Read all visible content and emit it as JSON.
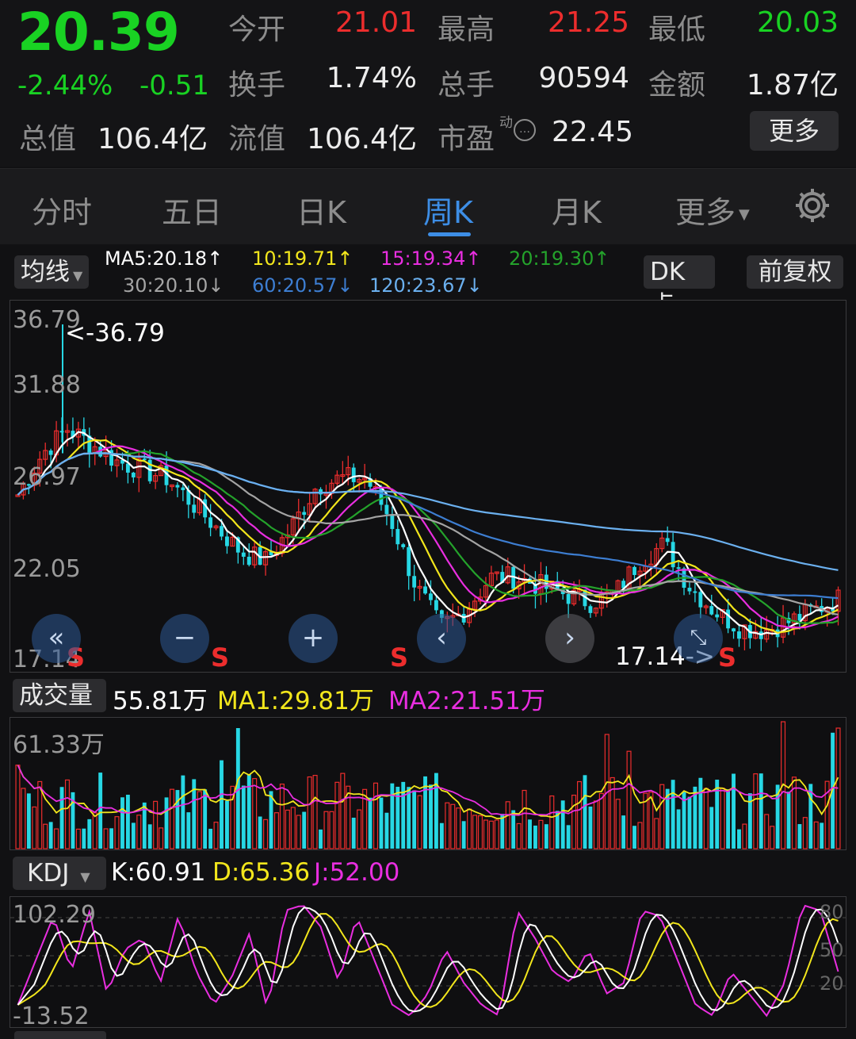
{
  "quote": {
    "price": "20.39",
    "change_pct": "-2.44%",
    "change": "-0.51",
    "open_label": "今开",
    "open": "21.01",
    "high_label": "最高",
    "high": "21.25",
    "low_label": "最低",
    "low": "20.03",
    "turnover_label": "换手",
    "turnover": "1.74%",
    "volume_label": "总手",
    "volume": "90594",
    "amount_label": "金额",
    "amount": "1.87亿",
    "mcap_label": "总值",
    "mcap": "106.4亿",
    "float_label": "流值",
    "float_cap": "106.4亿",
    "pe_label": "市盈",
    "pe_superscript": "动",
    "pe": "22.45",
    "more_label": "更多"
  },
  "tabs": {
    "items": [
      "分时",
      "五日",
      "日K",
      "周K",
      "月K",
      "更多"
    ],
    "active": "周K"
  },
  "ma_legend": {
    "dropdown": "均线",
    "ma5": "MA5:20.18↑",
    "ma10": "10:19.71↑",
    "ma15": "15:19.34↑",
    "ma20": "20:19.30↑",
    "ma30": "30:20.10↓",
    "ma60": "60:20.57↓",
    "ma120": "120:23.67↓",
    "dk_button": "DK点",
    "adjust_button": "前复权"
  },
  "colors": {
    "up": "#ec2d2d",
    "down": "#27d7e4",
    "price_green": "#19d223",
    "ma5": "#ffffff",
    "ma10": "#f2e61c",
    "ma15": "#e92ee0",
    "ma20": "#24a22b",
    "ma30": "#a4a4a4",
    "ma60": "#3d7ed2",
    "ma120": "#6bb0ef",
    "accent": "#3d8ee6"
  },
  "kline": {
    "y_labels": [
      "36.79",
      "31.88",
      "26.97",
      "22.05",
      "17.14"
    ],
    "max_mark": "<-36.79",
    "min_mark": "17.14->",
    "sell_signal": "S",
    "nav_icons": [
      "double-left-icon",
      "zoom-out-icon",
      "zoom-in-icon",
      "chevron-left-icon",
      "chevron-right-icon",
      "fullscreen-icon"
    ]
  },
  "volume": {
    "dropdown": "成交量",
    "value": "55.81万",
    "ma1": "MA1:29.81万",
    "ma2": "MA2:21.51万",
    "y_top": "61.33万"
  },
  "kdj": {
    "dropdown": "KDJ",
    "k": "K:60.91",
    "d": "D:65.36",
    "j": "J:52.00",
    "y_top": "102.29",
    "y_bottom": "-13.52",
    "right_levels": [
      "80",
      "50",
      "20"
    ]
  }
}
